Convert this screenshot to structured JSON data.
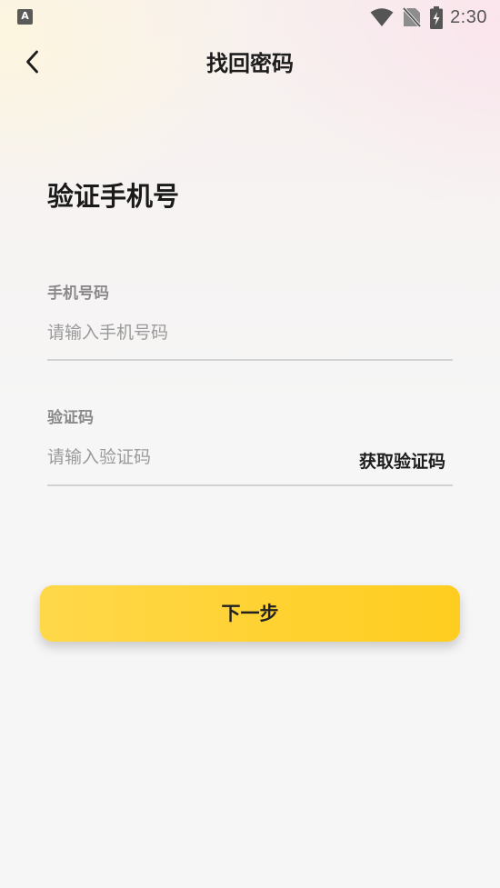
{
  "status_bar": {
    "app_icon_letter": "A",
    "time": "2:30",
    "icons": [
      "wifi-icon",
      "no-sim-icon",
      "battery-charging-icon"
    ]
  },
  "header": {
    "back_icon": "chevron-left-icon",
    "title": "找回密码"
  },
  "main": {
    "section_title": "验证手机号",
    "phone": {
      "label": "手机号码",
      "placeholder": "请输入手机号码",
      "value": ""
    },
    "code": {
      "label": "验证码",
      "placeholder": "请输入验证码",
      "value": "",
      "get_code_label": "获取验证码"
    },
    "next_label": "下一步"
  },
  "colors": {
    "accent": "#ffd031",
    "background": "#f6f6f6",
    "title_text": "#1d1d1d",
    "label_text": "#8a8a8a",
    "placeholder_text": "#9a9a9a",
    "divider": "#d2d2d2"
  }
}
